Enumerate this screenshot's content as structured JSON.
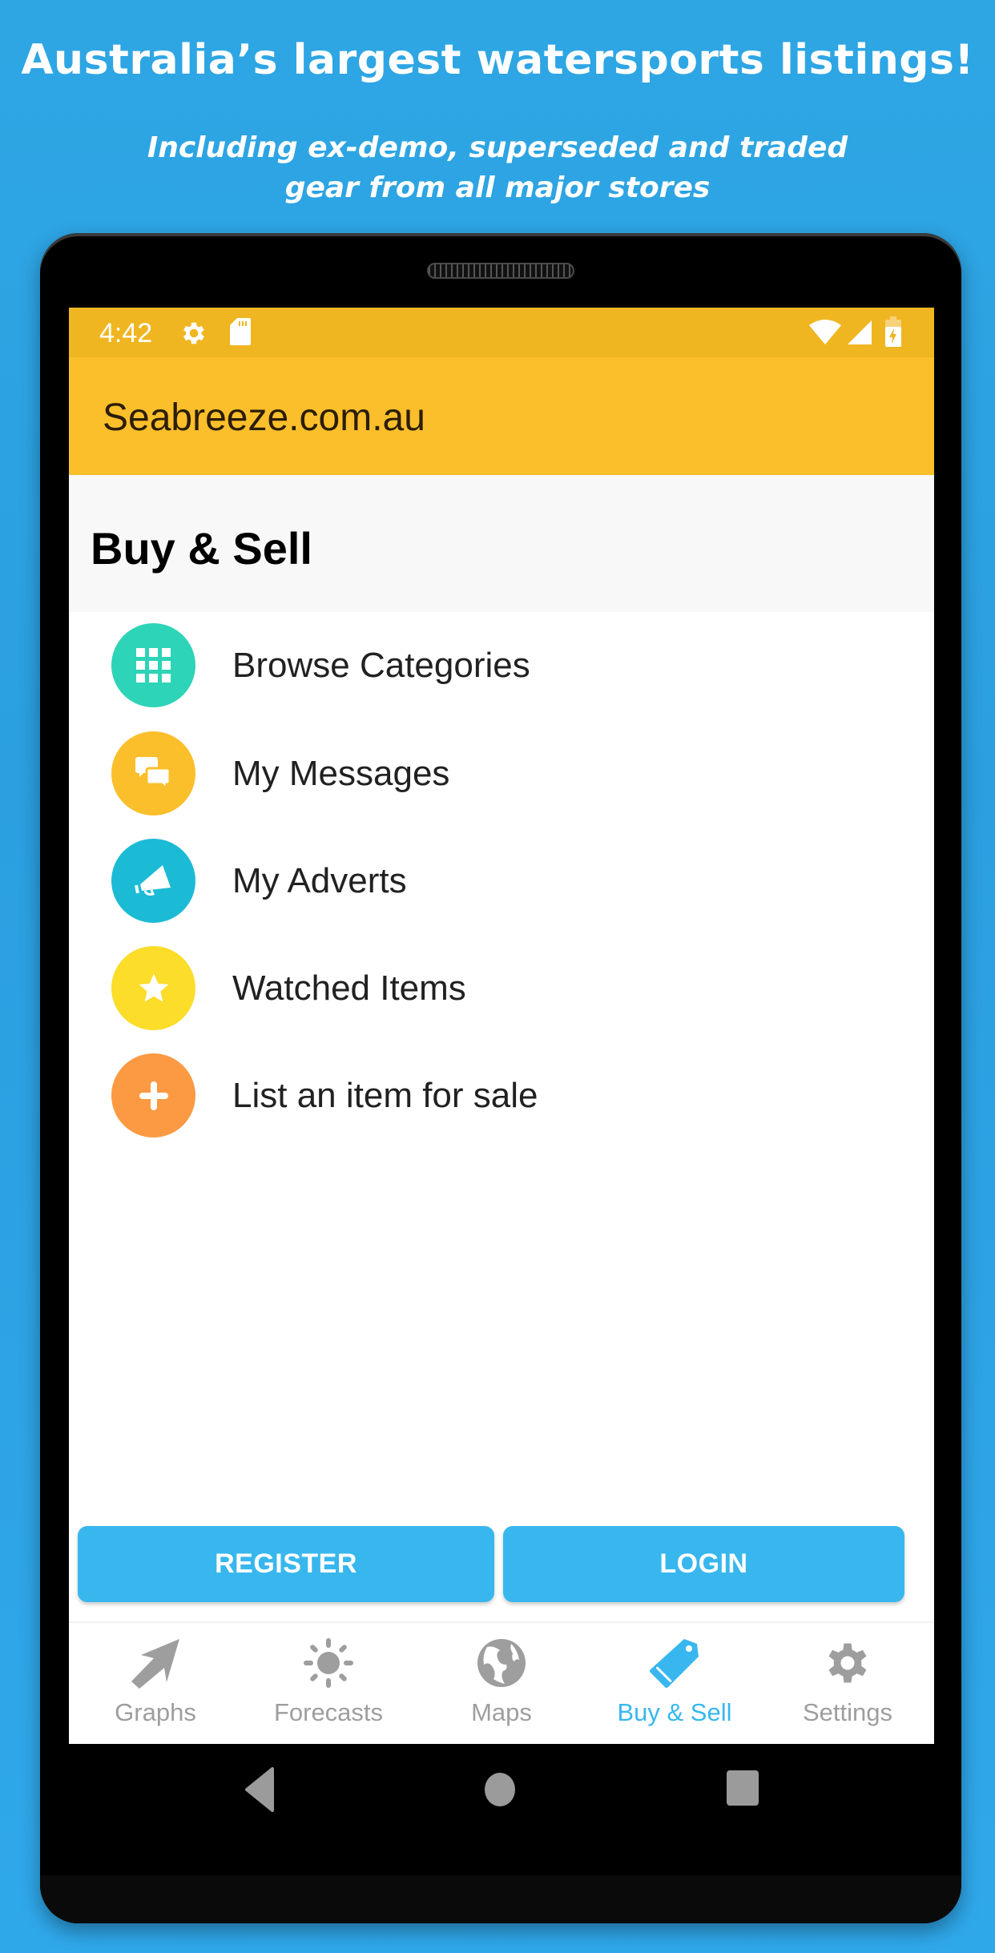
{
  "promo": {
    "title": "Australia’s largest watersports listings!",
    "subtitle_line1": "Including ex-demo, superseded and traded",
    "subtitle_line2": "gear from all major stores"
  },
  "status_bar": {
    "time": "4:42",
    "left_icons": [
      "settings-gear-icon",
      "sd-card-icon"
    ],
    "right_icons": [
      "wifi-icon",
      "cellular-signal-icon",
      "battery-charging-icon"
    ]
  },
  "app_bar": {
    "title": "Seabreeze.com.au"
  },
  "section": {
    "title": "Buy & Sell"
  },
  "menu": {
    "items": [
      {
        "label": "Browse Categories",
        "icon": "grid-icon",
        "color": "#2dd4b7"
      },
      {
        "label": "My Messages",
        "icon": "chat-bubbles-icon",
        "color": "#fbbf2b"
      },
      {
        "label": "My Adverts",
        "icon": "megaphone-icon",
        "color": "#1bbbd6"
      },
      {
        "label": "Watched Items",
        "icon": "star-icon",
        "color": "#fbdd2a"
      },
      {
        "label": "List an item for sale",
        "icon": "plus-icon",
        "color": "#fb9a42"
      }
    ]
  },
  "buttons": {
    "register": "REGISTER",
    "login": "LOGIN"
  },
  "bottom_nav": {
    "active": "Buy & Sell",
    "tabs": [
      {
        "label": "Graphs",
        "icon": "arrow-icon"
      },
      {
        "label": "Forecasts",
        "icon": "sun-icon"
      },
      {
        "label": "Maps",
        "icon": "globe-icon"
      },
      {
        "label": "Buy & Sell",
        "icon": "tag-icon"
      },
      {
        "label": "Settings",
        "icon": "gear-icon"
      }
    ]
  },
  "colors": {
    "background": "#2ea6e4",
    "status_bar": "#efb621",
    "app_bar": "#fbbf2b",
    "accent": "#38b7ee",
    "inactive_nav": "#9e9e9e"
  }
}
